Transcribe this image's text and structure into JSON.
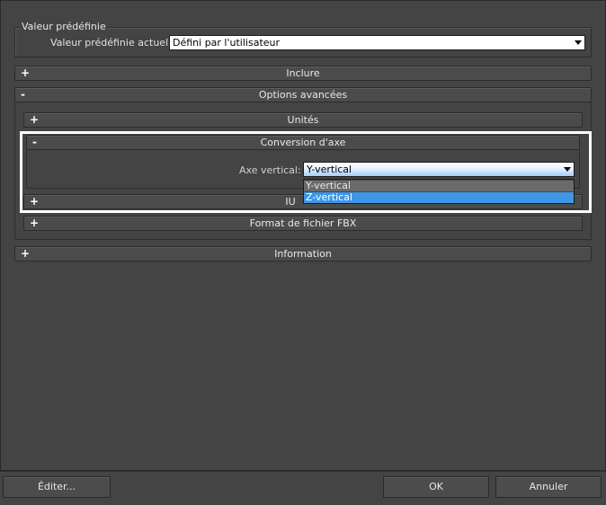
{
  "preset": {
    "group_title": "Valeur prédéfinie",
    "current_label": "Valeur prédéfinie actuelle:",
    "current_value": "Défini par l'utilisateur"
  },
  "rollouts": {
    "include": {
      "sign": "+",
      "title": "Inclure"
    },
    "advanced": {
      "sign": "-",
      "title": "Options avancées"
    },
    "units": {
      "sign": "+",
      "title": "Unités"
    },
    "axis_conversion": {
      "sign": "-",
      "title": "Conversion d'axe"
    },
    "ui": {
      "sign": "+",
      "title": "IU"
    },
    "fbx_format": {
      "sign": "+",
      "title": "Format de fichier FBX"
    },
    "information": {
      "sign": "+",
      "title": "Information"
    }
  },
  "axis": {
    "label": "Axe vertical:",
    "value": "Y-vertical",
    "options": [
      "Y-vertical",
      "Z-vertical"
    ],
    "highlighted_option": "Z-vertical"
  },
  "buttons": {
    "edit": "Éditer...",
    "ok": "OK",
    "cancel": "Annuler"
  }
}
